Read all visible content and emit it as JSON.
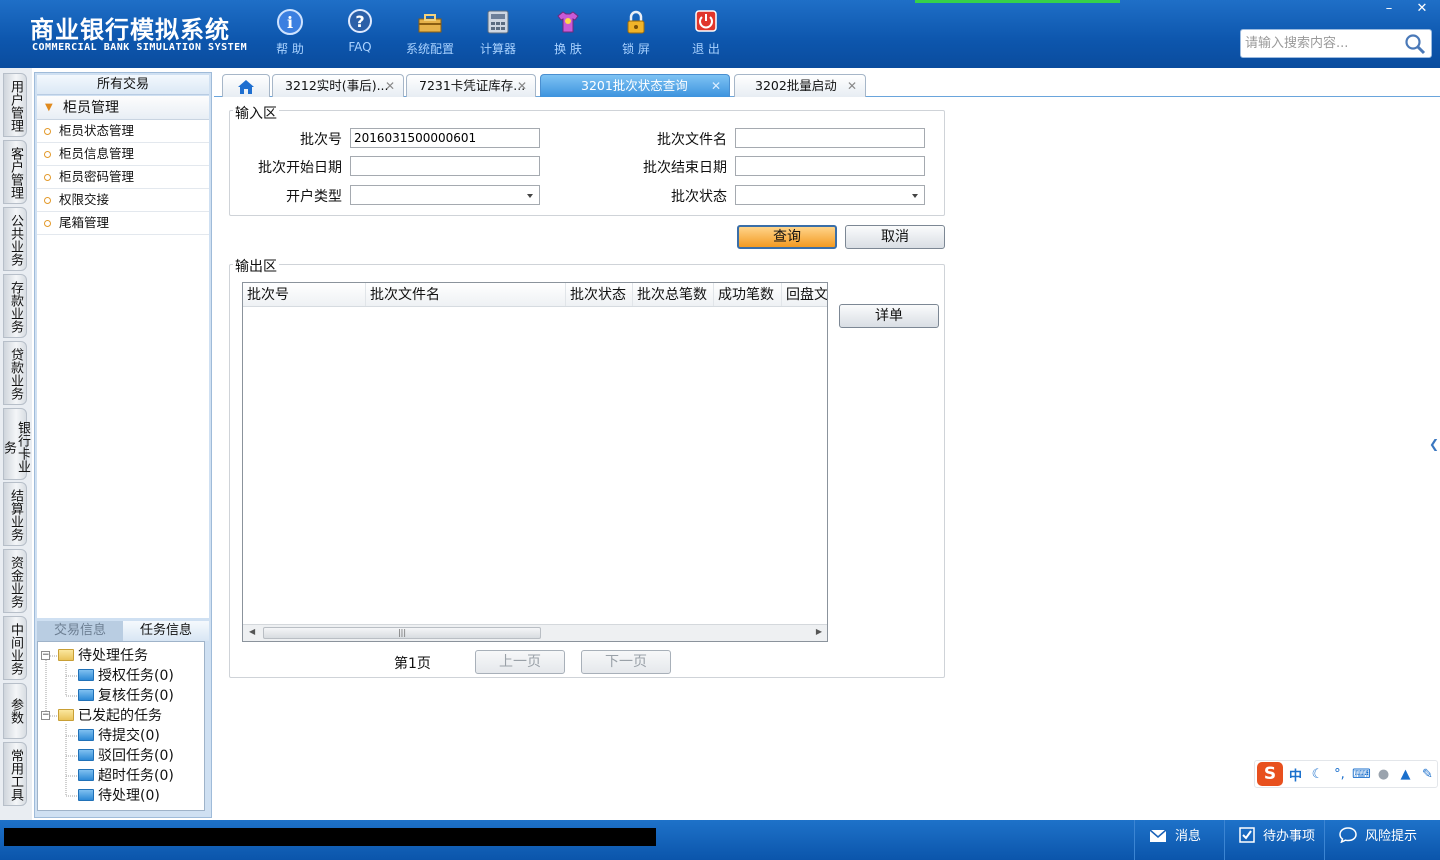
{
  "header": {
    "brand_cn": "商业银行模拟系统",
    "brand_en": "COMMERCIAL BANK SIMULATION SYSTEM",
    "tools": [
      {
        "label": "帮 助",
        "icon": "help-icon"
      },
      {
        "label": "FAQ",
        "icon": "faq-icon"
      },
      {
        "label": "系统配置",
        "icon": "toolbox-icon"
      },
      {
        "label": "计算器",
        "icon": "calculator-icon"
      },
      {
        "label": "换 肤",
        "icon": "shirt-icon"
      },
      {
        "label": "锁 屏",
        "icon": "lock-icon"
      },
      {
        "label": "退 出",
        "icon": "power-icon"
      }
    ],
    "win_min": "–",
    "win_close": "✕",
    "search_placeholder": "请输入搜索内容..."
  },
  "vnav": [
    "用户管理",
    "客户管理",
    "公共业务",
    "存款业务",
    "贷款业务",
    "银行卡业务",
    "结算业务",
    "资金业务",
    "中间业务",
    "参数",
    "常用工具"
  ],
  "left_panel": {
    "title": "所有交易",
    "group": "柜员管理",
    "items": [
      "柜员状态管理",
      "柜员信息管理",
      "柜员密码管理",
      "权限交接",
      "尾箱管理"
    ],
    "tabs": [
      "交易信息",
      "任务信息"
    ],
    "tree": {
      "pending": "待处理任务",
      "auth": "授权任务(0)",
      "review": "复核任务(0)",
      "initiated": "已发起的任务",
      "to_submit": "待提交(0)",
      "rejected": "驳回任务(0)",
      "timeout": "超时任务(0)",
      "to_process": "待处理(0)"
    }
  },
  "tabs": [
    {
      "label": "3212实时(事后)...",
      "active": false
    },
    {
      "label": "7231卡凭证库存...",
      "active": false
    },
    {
      "label": "3201批次状态查询",
      "active": true
    },
    {
      "label": "3202批量启动",
      "active": false
    }
  ],
  "form": {
    "input_legend": "输入区",
    "batch_no_label": "批次号",
    "batch_no_value": "2016031500000601",
    "batch_file_label": "批次文件名",
    "batch_file_value": "",
    "start_date_label": "批次开始日期",
    "start_date_value": "",
    "end_date_label": "批次结束日期",
    "end_date_value": "",
    "account_type_label": "开户类型",
    "account_type_value": "",
    "batch_status_label": "批次状态",
    "batch_status_value": "",
    "query_button": "查询",
    "cancel_button": "取消"
  },
  "output": {
    "legend": "输出区",
    "columns": [
      "批次号",
      "批次文件名",
      "批次状态",
      "批次总笔数",
      "成功笔数",
      "回盘文"
    ],
    "rows": [],
    "detail_button": "详单",
    "page_label": "第1页",
    "prev_button": "上一页",
    "next_button": "下一页"
  },
  "footer": {
    "message": "消息",
    "todo": "待办事项",
    "risk": "风险提示"
  },
  "ime": {
    "logo": "S",
    "mode": "中"
  }
}
